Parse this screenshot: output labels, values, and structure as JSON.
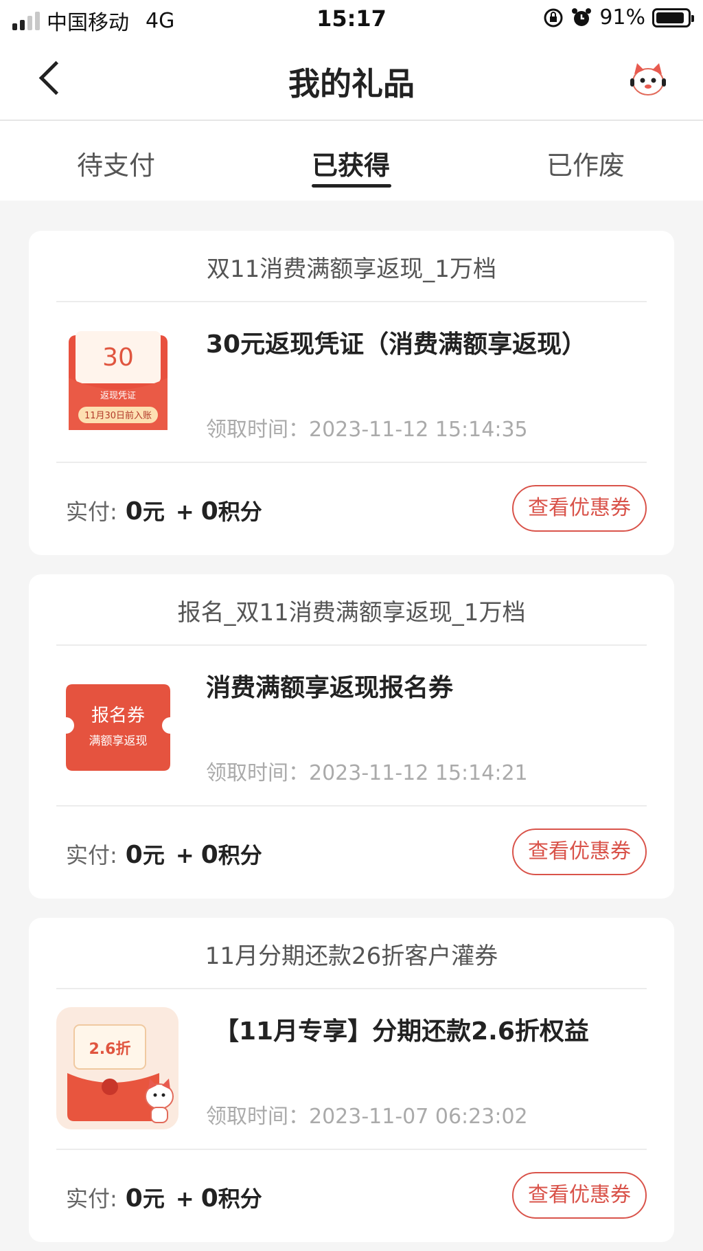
{
  "status_bar": {
    "carrier": "中国移动",
    "network": "4G",
    "time": "15:17",
    "battery_percent": "91%",
    "battery_level": 0.91
  },
  "header": {
    "title": "我的礼品"
  },
  "tabs": [
    {
      "label": "待支付",
      "active": false
    },
    {
      "label": "已获得",
      "active": true
    },
    {
      "label": "已作废",
      "active": false
    }
  ],
  "colors": {
    "accent_red": "#d9534a",
    "page_bg": "#f5f5f5"
  },
  "gifts": [
    {
      "campaign": "双11消费满额享返现_1万档",
      "name": "30元返现凭证（消费满额享返现）",
      "time_label": "领取时间：",
      "time": "2023-11-12 15:14:35",
      "thumb": {
        "amount": "30",
        "caption": "返现凭证",
        "note": "11月30日前入账"
      },
      "pay_label": "实付:",
      "pay_amount": "0",
      "pay_unit": "元",
      "plus": "+",
      "points_amount": "0",
      "points_unit": "积分",
      "button": "查看优惠券"
    },
    {
      "campaign": "报名_双11消费满额享返现_1万档",
      "name": "消费满额享返现报名券",
      "time_label": "领取时间：",
      "time": "2023-11-12 15:14:21",
      "thumb": {
        "title": "报名券",
        "subtitle": "满额享返现"
      },
      "pay_label": "实付:",
      "pay_amount": "0",
      "pay_unit": "元",
      "plus": "+",
      "points_amount": "0",
      "points_unit": "积分",
      "button": "查看优惠券"
    },
    {
      "campaign": "11月分期还款26折客户灌券",
      "name": "【11月专享】分期还款2.6折权益",
      "time_label": "领取时间：",
      "time": "2023-11-07 06:23:02",
      "thumb": {
        "label": "2.6折"
      },
      "pay_label": "实付:",
      "pay_amount": "0",
      "pay_unit": "元",
      "plus": "+",
      "points_amount": "0",
      "points_unit": "积分",
      "button": "查看优惠券"
    }
  ]
}
